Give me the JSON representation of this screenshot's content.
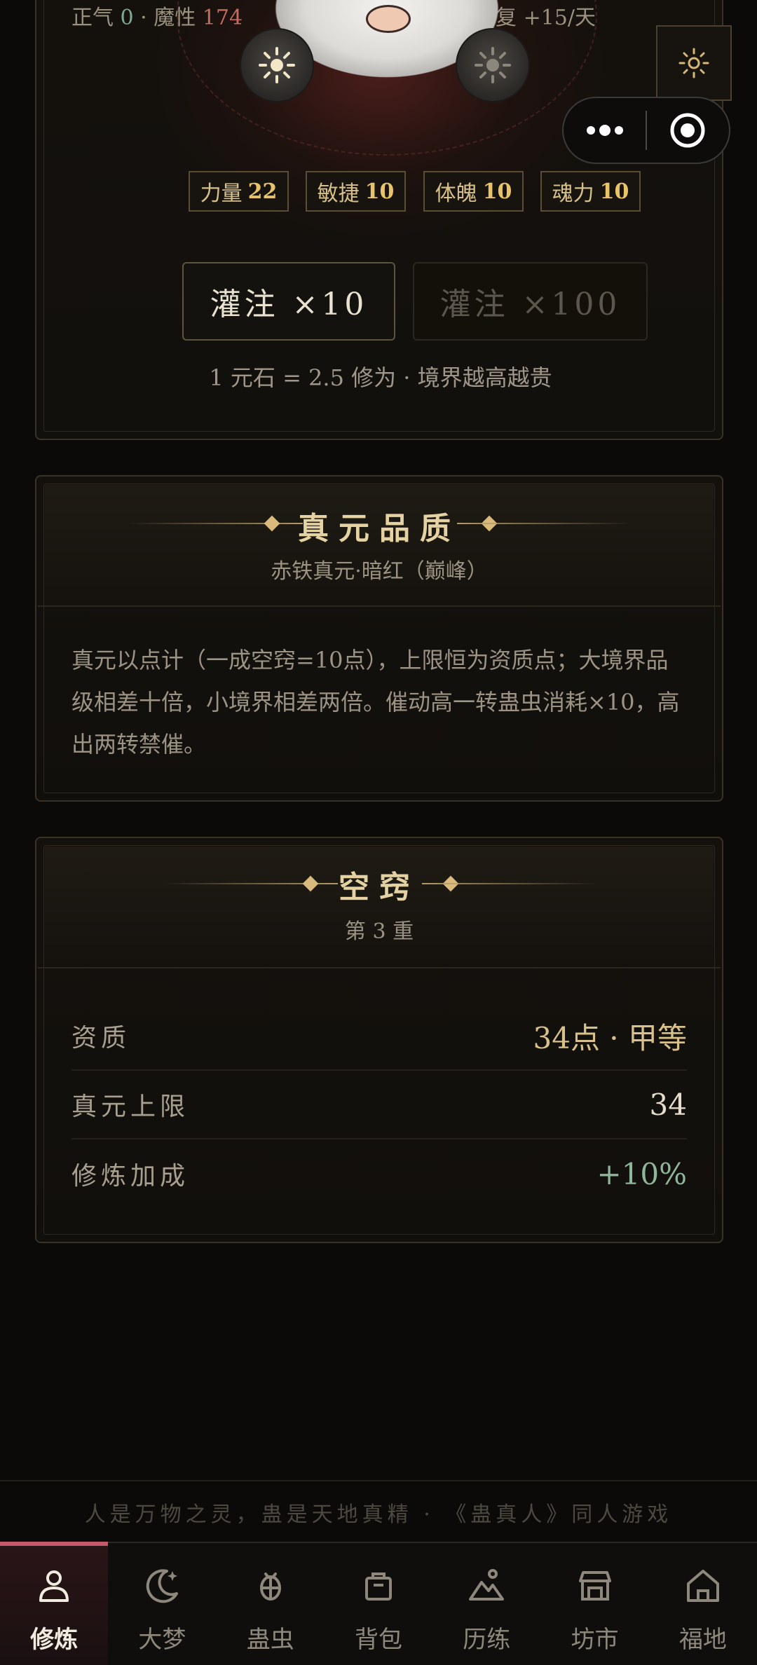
{
  "top_card": {
    "stat_left_prefix": "正气 ",
    "stat_left_zhengqi": "0",
    "stat_left_mid": " · 魔性 ",
    "stat_left_moxing": "174",
    "stat_right": "恢复 +15/天",
    "attributes": [
      {
        "label": "力量",
        "value": "22"
      },
      {
        "label": "敏捷",
        "value": "10"
      },
      {
        "label": "体魄",
        "value": "10"
      },
      {
        "label": "魂力",
        "value": "10"
      }
    ],
    "infuse_10": "灌注 ×10",
    "infuse_100": "灌注 ×100",
    "rate_note": "1 元石 = 2.5 修为 · 境界越高越贵"
  },
  "quality_card": {
    "title": "真元品质",
    "subtitle": "赤铁真元·暗红（巅峰）",
    "description": "真元以点计（一成空窍=10点），上限恒为资质点；大境界品级相差十倍，小境界相差两倍。催动高一转蛊虫消耗×10，高出两转禁催。"
  },
  "aperture_card": {
    "title": "空窍",
    "subtitle": "第 3 重",
    "rows": [
      {
        "label": "资质",
        "value": "34点 · 甲等"
      },
      {
        "label": "真元上限",
        "value": "34"
      },
      {
        "label": "修炼加成",
        "value": "+10%"
      }
    ]
  },
  "footer_text": "人是万物之灵，蛊是天地真精 · 《蛊真人》同人游戏",
  "nav": [
    {
      "label": "修炼",
      "icon": "person-icon"
    },
    {
      "label": "大梦",
      "icon": "moon-icon"
    },
    {
      "label": "蛊虫",
      "icon": "bug-icon"
    },
    {
      "label": "背包",
      "icon": "bag-icon"
    },
    {
      "label": "历练",
      "icon": "mountain-icon"
    },
    {
      "label": "坊市",
      "icon": "shop-icon"
    },
    {
      "label": "福地",
      "icon": "home-icon"
    }
  ],
  "colors": {
    "accent_gold": "#d8c08a",
    "active_tab": "#c75a6a",
    "positive": "#8fb59a",
    "moxing": "#c26b5e"
  }
}
